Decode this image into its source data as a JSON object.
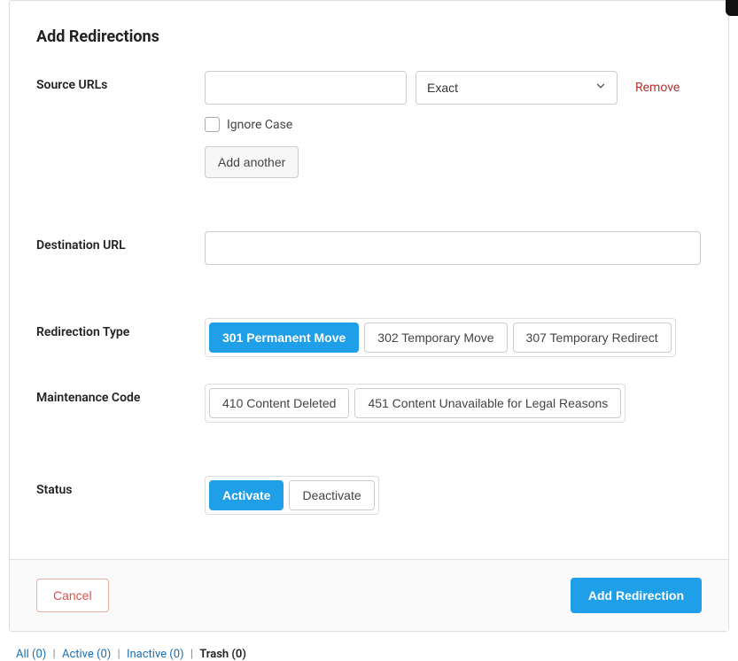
{
  "panel": {
    "title": "Add Redirections"
  },
  "labels": {
    "sourceUrls": "Source URLs",
    "destinationUrl": "Destination URL",
    "redirectionType": "Redirection Type",
    "maintenanceCode": "Maintenance Code",
    "status": "Status"
  },
  "source": {
    "value": "",
    "matchType": "Exact",
    "removeLabel": "Remove",
    "ignoreCaseLabel": "Ignore Case",
    "ignoreCaseChecked": false,
    "addAnotherLabel": "Add another"
  },
  "destination": {
    "value": ""
  },
  "redirectionTypes": [
    {
      "label": "301 Permanent Move",
      "active": true
    },
    {
      "label": "302 Temporary Move",
      "active": false
    },
    {
      "label": "307 Temporary Redirect",
      "active": false
    }
  ],
  "maintenanceCodes": [
    {
      "label": "410 Content Deleted",
      "active": false
    },
    {
      "label": "451 Content Unavailable for Legal Reasons",
      "active": false
    }
  ],
  "statusOptions": [
    {
      "label": "Activate",
      "active": true
    },
    {
      "label": "Deactivate",
      "active": false
    }
  ],
  "footer": {
    "cancelLabel": "Cancel",
    "submitLabel": "Add Redirection"
  },
  "tabs": {
    "all": "All (0)",
    "active": "Active (0)",
    "inactive": "Inactive (0)",
    "trash": "Trash (0)"
  }
}
